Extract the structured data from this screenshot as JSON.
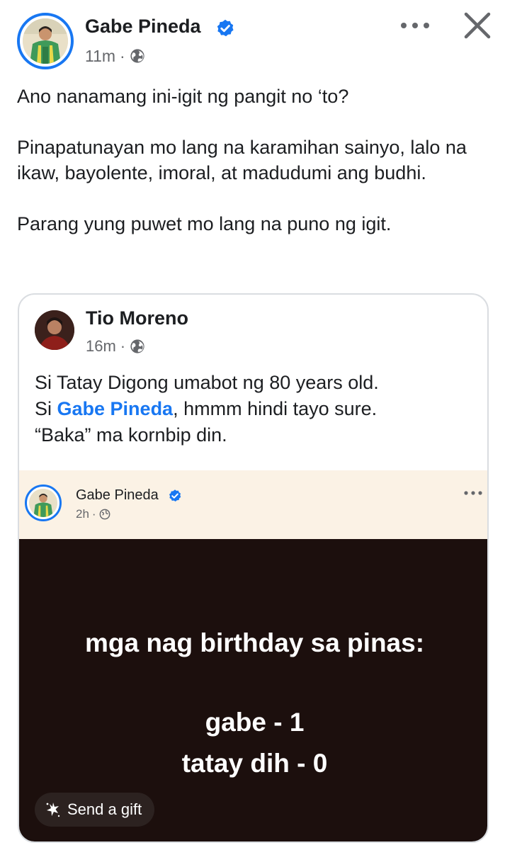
{
  "post": {
    "author": "Gabe Pineda",
    "time": "11m",
    "separator": "·",
    "text": [
      "Ano nanamang ini-igit ng pangit no ‘to?",
      "Pinapatunayan mo lang na karamihan sainyo, lalo na ikaw, bayolente, imoral, at madudumi ang budhi.",
      "Parang yung puwet mo lang na puno ng igit."
    ]
  },
  "shared": {
    "author": "Tio Moreno",
    "time": "16m",
    "separator": "·",
    "line1": "Si Tatay Digong umabot ng 80 years old.",
    "line2_prefix": "Si ",
    "mention": "Gabe Pineda",
    "line2_suffix": ", hmmm hindi tayo sure.",
    "line3": "“Baka” ma kornbip din."
  },
  "embedded": {
    "author": "Gabe Pineda",
    "time": "2h",
    "separator": "·",
    "image_lines": [
      "mga nag birthday sa pinas:",
      "gabe - 1",
      "tatay dih - 0"
    ]
  },
  "gift": {
    "label": "Send a gift"
  },
  "icons": {
    "verified": "verified-badge-icon",
    "globe": "globe-icon",
    "more": "more-dots-icon",
    "close": "close-icon",
    "gift": "gift-icon"
  },
  "colors": {
    "accent": "#1877f2",
    "text": "#1c1e21",
    "secondary": "#65676b",
    "embedded_header_bg": "#fbf2e5",
    "image_bg": "#1c0f0d"
  }
}
